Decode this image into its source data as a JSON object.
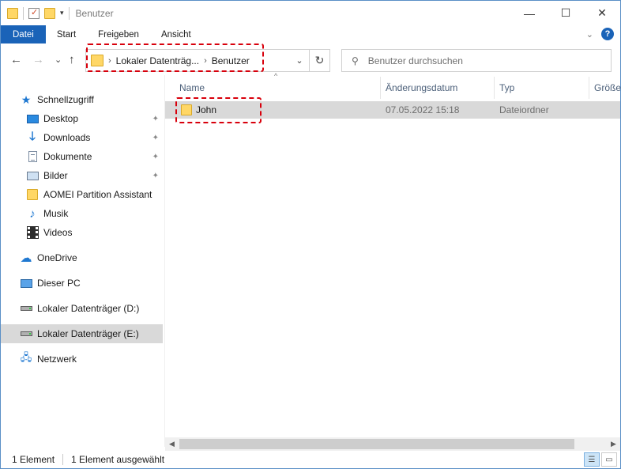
{
  "window": {
    "title": "Benutzer",
    "minimize_glyph": "—",
    "maximize_glyph": "☐",
    "close_glyph": "✕"
  },
  "quick_access_toolbar": {
    "dropdown_glyph": "▾"
  },
  "ribbon": {
    "tabs": [
      {
        "label": "Datei"
      },
      {
        "label": "Start"
      },
      {
        "label": "Freigeben"
      },
      {
        "label": "Ansicht"
      }
    ],
    "expand_glyph": "⌄",
    "help_glyph": "?"
  },
  "navigation": {
    "back_glyph": "←",
    "forward_glyph": "→",
    "recent_glyph": "⌄",
    "up_glyph": "↑",
    "breadcrumb": [
      {
        "label": "Lokaler Datenträg..."
      },
      {
        "label": "Benutzer"
      }
    ],
    "breadcrumb_sep": "›",
    "address_dropdown_glyph": "⌄",
    "refresh_glyph": "↻",
    "search_placeholder": "Benutzer durchsuchen",
    "search_glyph": "⚲"
  },
  "sidebar": {
    "quick_access": {
      "label": "Schnellzugriff",
      "icon": "star-icon"
    },
    "items": [
      {
        "label": "Desktop",
        "icon": "desktop-icon",
        "pinned": true
      },
      {
        "label": "Downloads",
        "icon": "download-icon",
        "pinned": true
      },
      {
        "label": "Dokumente",
        "icon": "document-icon",
        "pinned": true
      },
      {
        "label": "Bilder",
        "icon": "pictures-icon",
        "pinned": true
      },
      {
        "label": "AOMEI Partition Assistant",
        "icon": "folder-icon",
        "pinned": false
      },
      {
        "label": "Musik",
        "icon": "music-icon",
        "pinned": false
      },
      {
        "label": "Videos",
        "icon": "video-icon",
        "pinned": false
      }
    ],
    "roots": [
      {
        "label": "OneDrive",
        "icon": "cloud-icon"
      },
      {
        "label": "Dieser PC",
        "icon": "pc-icon"
      },
      {
        "label": "Lokaler Datenträger (D:)",
        "icon": "drive-icon"
      },
      {
        "label": "Lokaler Datenträger (E:)",
        "icon": "drive-icon",
        "selected": true
      },
      {
        "label": "Netzwerk",
        "icon": "network-icon"
      }
    ],
    "pin_glyph": "📌"
  },
  "file_list": {
    "columns": [
      {
        "label": "Name"
      },
      {
        "label": "Änderungsdatum"
      },
      {
        "label": "Typ"
      },
      {
        "label": "Größe"
      }
    ],
    "sort_glyph": "^",
    "rows": [
      {
        "name": "John",
        "modified": "07.05.2022 15:18",
        "type": "Dateiordner",
        "size": "",
        "selected": true
      }
    ]
  },
  "status_bar": {
    "item_count": "1 Element",
    "selection": "1 Element ausgewählt"
  },
  "colors": {
    "accent": "#1a63b8",
    "highlight_annotation": "#d8000c",
    "selection": "#d9d9d9",
    "folder": "#ffd766"
  }
}
